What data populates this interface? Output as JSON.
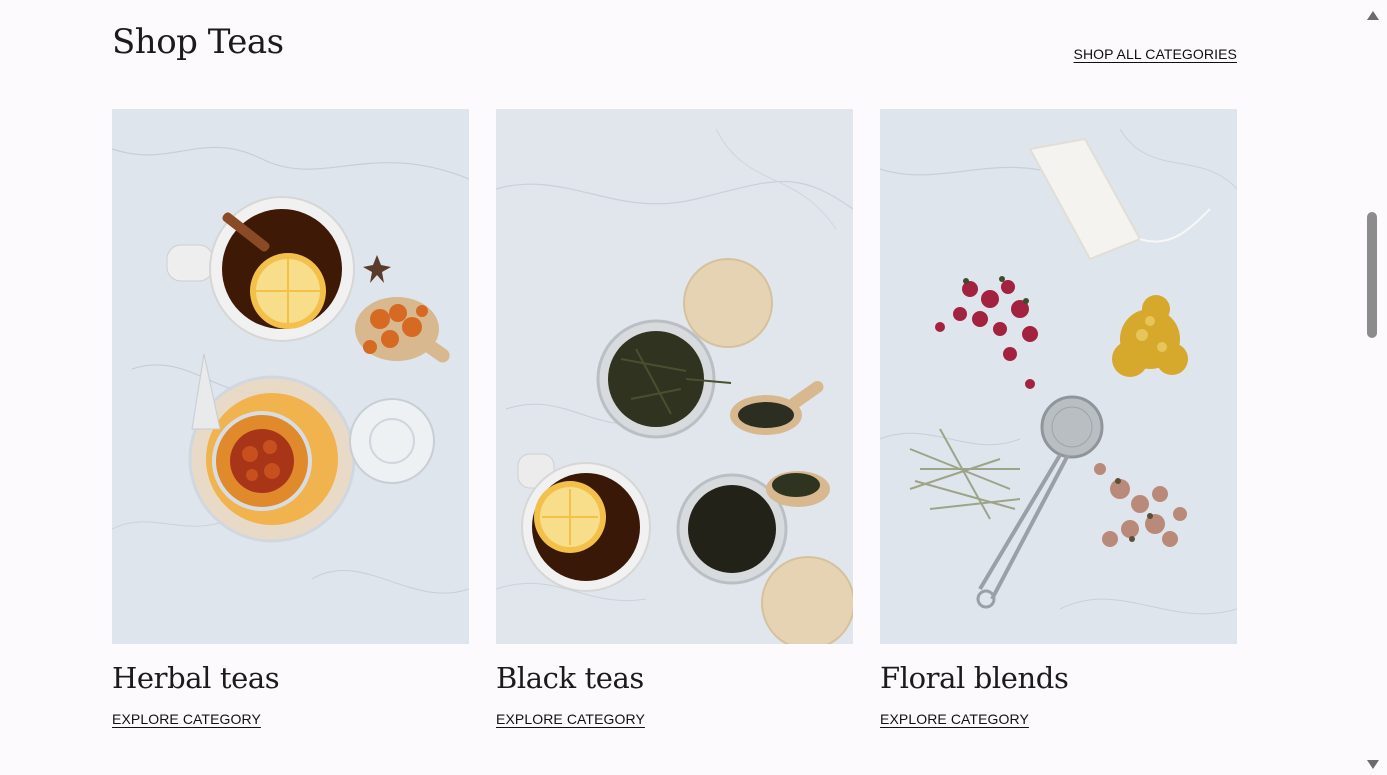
{
  "section": {
    "title": "Shop Teas",
    "shop_all_label": "SHOP ALL CATEGORIES"
  },
  "cards": [
    {
      "title": "Herbal teas",
      "link_label": "EXPLORE CATEGORY",
      "image": "herbal-tea-photo"
    },
    {
      "title": "Black teas",
      "link_label": "EXPLORE CATEGORY",
      "image": "black-tea-photo"
    },
    {
      "title": "Floral blends",
      "link_label": "EXPLORE CATEGORY",
      "image": "floral-blend-photo"
    }
  ],
  "colors": {
    "background": "#fdfafd",
    "text": "#1b1b1b",
    "marble": "#dfe5ec"
  }
}
